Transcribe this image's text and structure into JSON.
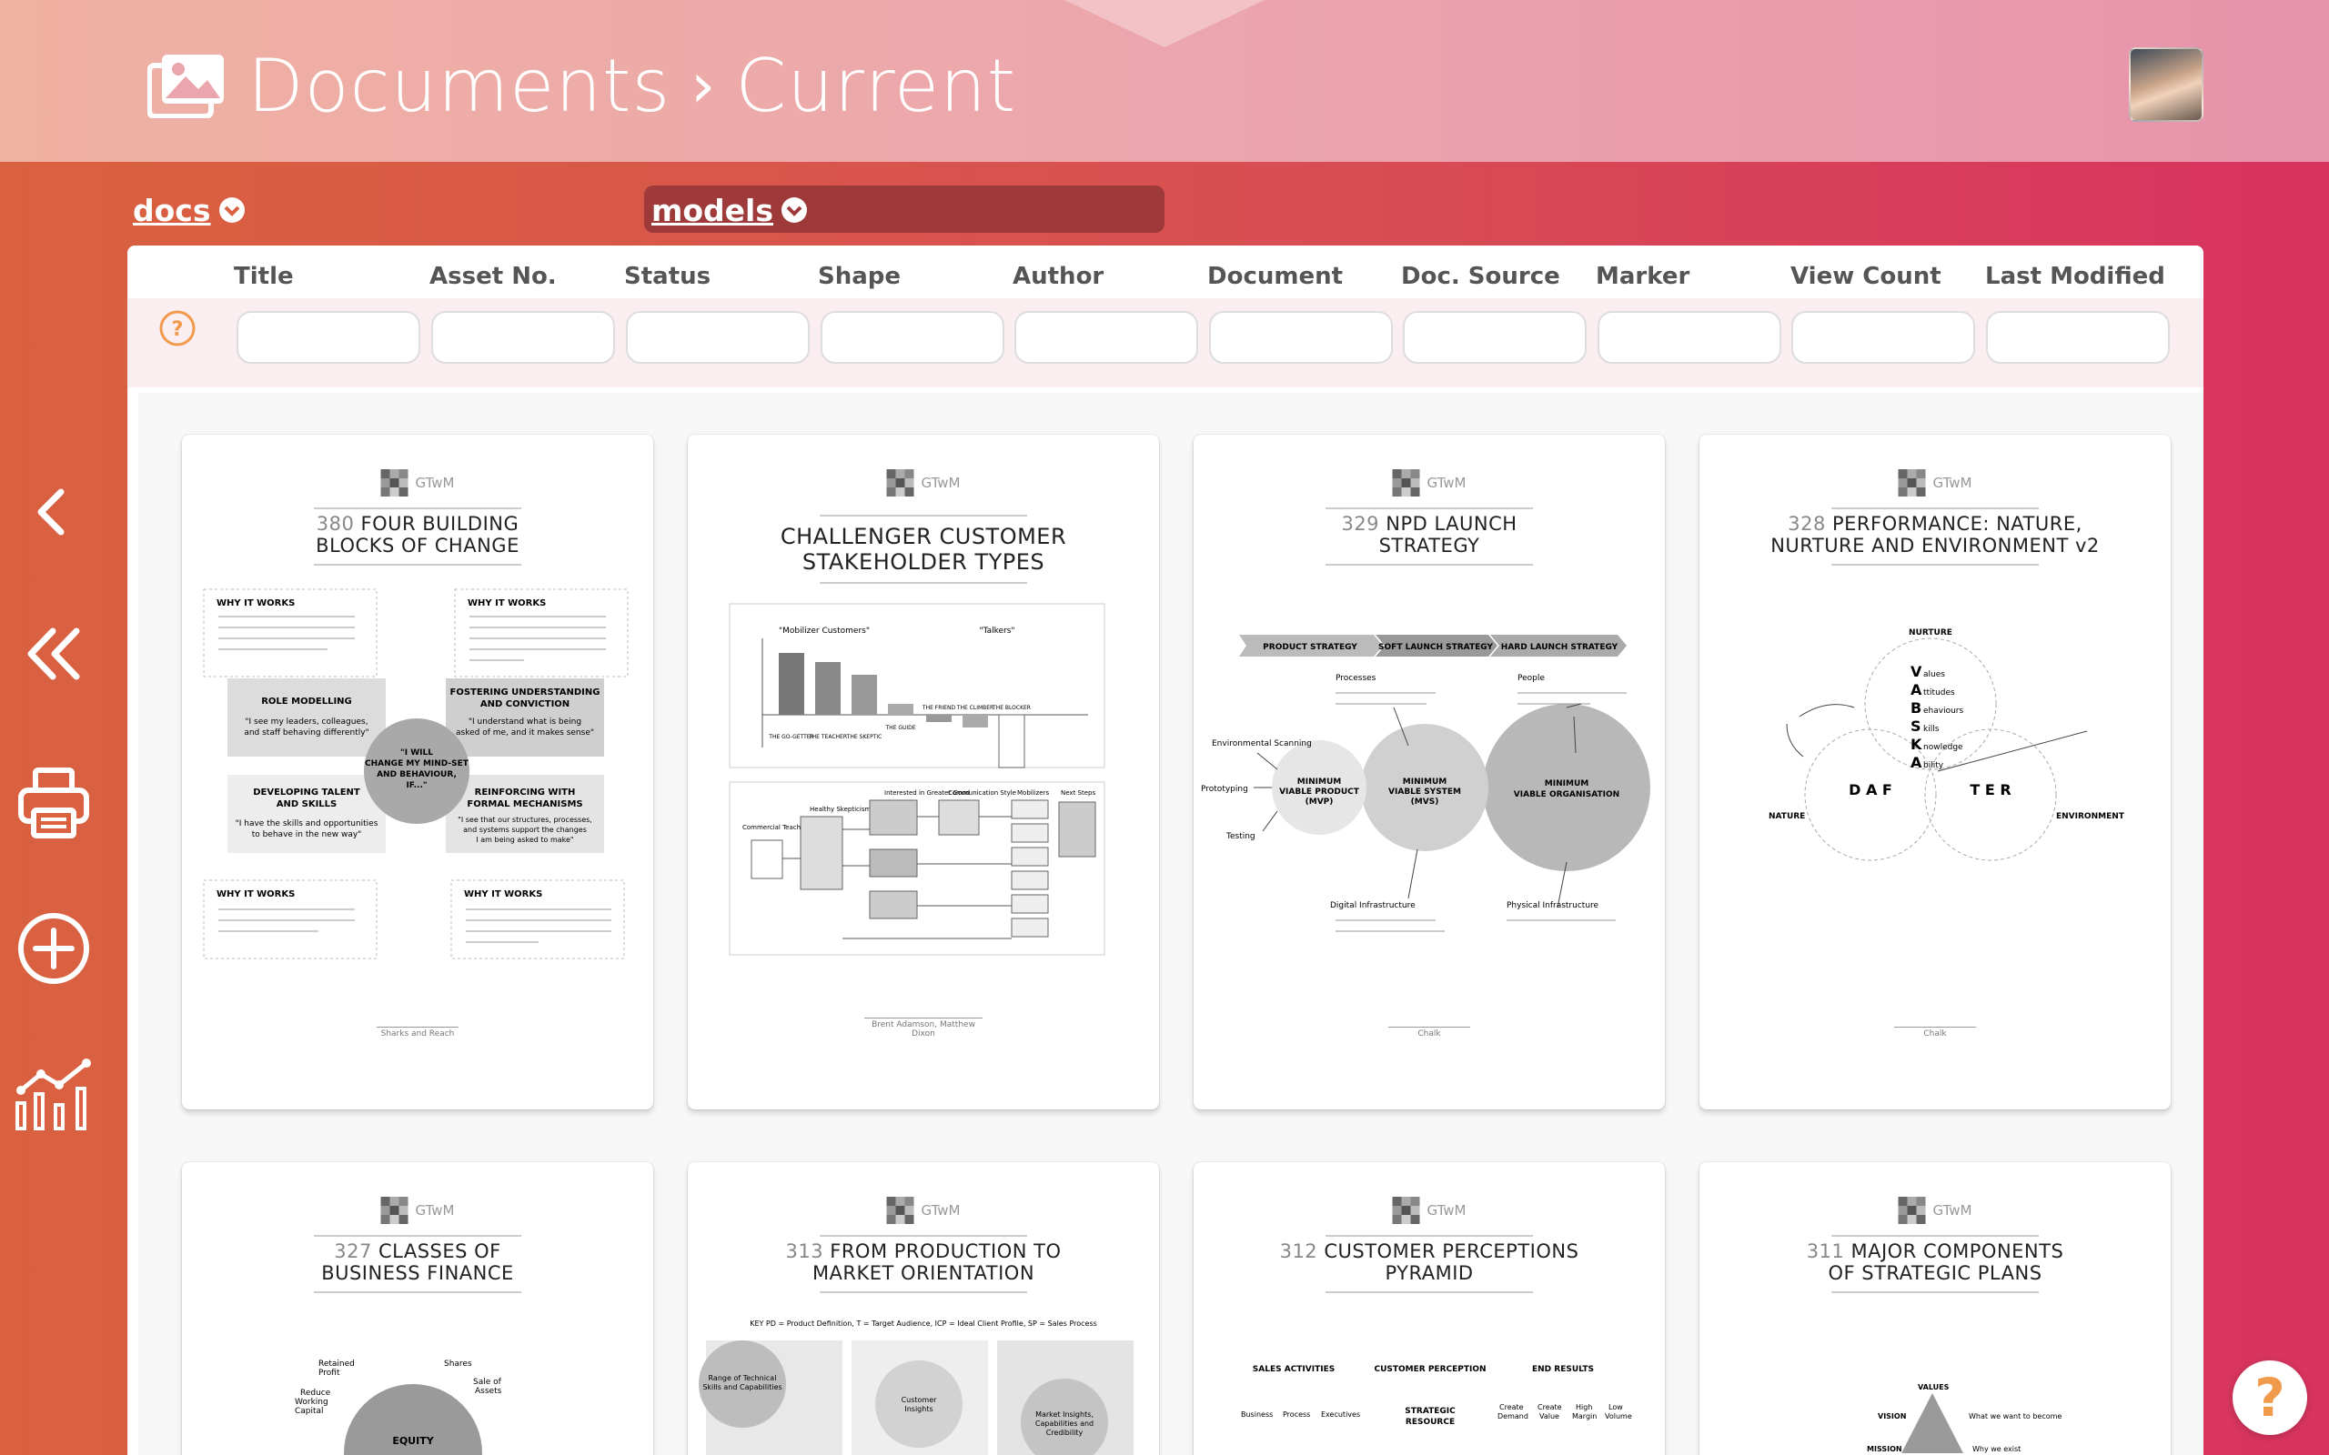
{
  "header": {
    "breadcrumb_root": "Documents",
    "breadcrumb_separator": "›",
    "breadcrumb_current": "Current"
  },
  "filters": {
    "docs_label": "docs",
    "models_label": "models"
  },
  "columns": [
    "Title",
    "Asset No.",
    "Status",
    "Shape",
    "Author",
    "Document",
    "Doc. Source",
    "Marker",
    "View Count",
    "Last Modified"
  ],
  "brand": "GTwM",
  "cards": [
    {
      "num": "380",
      "title_line1": "FOUR BUILDING",
      "title_line2": "BLOCKS OF CHANGE",
      "footer": "Sharks and Reach"
    },
    {
      "num": "",
      "title_line1": "CHALLENGER CUSTOMER",
      "title_line2": "STAKEHOLDER TYPES",
      "footer": "Brent Adamson, Matthew Dixon"
    },
    {
      "num": "329",
      "title_line1": "NPD LAUNCH",
      "title_line2": "STRATEGY",
      "footer": "Chalk"
    },
    {
      "num": "328",
      "title_line1": "PERFORMANCE: NATURE,",
      "title_line2": "NURTURE AND ENVIRONMENT v2",
      "footer": "Chalk"
    },
    {
      "num": "327",
      "title_line1": "CLASSES OF",
      "title_line2": "BUSINESS FINANCE",
      "footer": ""
    },
    {
      "num": "313",
      "title_line1": "FROM PRODUCTION TO",
      "title_line2": "MARKET ORIENTATION",
      "footer": ""
    },
    {
      "num": "312",
      "title_line1": "CUSTOMER PERCEPTIONS",
      "title_line2": "PYRAMID",
      "footer": ""
    },
    {
      "num": "311",
      "title_line1": "MAJOR COMPONENTS",
      "title_line2": "OF STRATEGIC PLANS",
      "footer": ""
    }
  ],
  "card_content": {
    "c0": {
      "why": "WHY IT WORKS",
      "role": "ROLE MODELLING",
      "role_q": "\"I see my leaders, colleagues, and staff behaving differently\"",
      "fost1": "FOSTERING UNDERSTANDING",
      "fost2": "AND CONVICTION",
      "fost_q": "\"I understand what is being asked of me, and it makes sense\"",
      "center1": "\"I WILL",
      "center2": "CHANGE MY MIND-SET",
      "center3": "AND BEHAVIOUR,",
      "center4": "IF...\"",
      "dev1": "DEVELOPING TALENT",
      "dev2": "AND SKILLS",
      "dev_q": "\"I have the skills and opportunities to behave in the new way\"",
      "reinf1": "REINFORCING WITH",
      "reinf2": "FORMAL MECHANISMS",
      "reinf_q": "\"I see that our structures, processes, and systems support the changes I am being asked to make\""
    },
    "c1": {
      "mob": "\"Mobilizer Customers\"",
      "talk": "\"Talkers\"",
      "bars": [
        "THE GO-GETTER",
        "THE TEACHER",
        "THE SKEPTIC",
        "THE GUIDE",
        "THE FRIEND",
        "THE CLIMBER",
        "THE BLOCKER"
      ],
      "flow": [
        "Commercial Teaching",
        "Healthy Skepticism",
        "Interested in Greater Good",
        "Communication Style",
        "Mobilizers",
        "Next Steps"
      ]
    },
    "c2": {
      "chev1": "PRODUCT STRATEGY",
      "chev2": "SOFT LAUNCH STRATEGY",
      "chev3": "HARD LAUNCH STRATEGY",
      "mvp1": "MINIMUM",
      "mvp2": "VIABLE PRODUCT",
      "mvp3": "(MVP)",
      "mvs1": "MINIMUM",
      "mvs2": "VIABLE SYSTEM",
      "mvs3": "(MVS)",
      "mvo1": "MINIMUM",
      "mvo2": "VIABLE ORGANISATION",
      "processes": "Processes",
      "people": "People",
      "env": "Environmental Scanning",
      "proto": "Prototyping",
      "testing": "Testing",
      "digital": "Digital Infrastructure",
      "physical": "Physical Infrastructure"
    },
    "c3": {
      "nurture": "NURTURE",
      "nature": "NATURE",
      "environment": "ENVIRONMENT",
      "vabsk": [
        "V",
        "A",
        "B",
        "S",
        "K",
        "A"
      ],
      "vabsk_rest": [
        "alues",
        "ttitudes",
        "ehaviours",
        "kills",
        "nowledge",
        "bility"
      ],
      "daf": "D A F",
      "ter": "T E R"
    },
    "c4": {
      "retained": "Retained Profit",
      "shares": "Shares",
      "reduce": "Reduce Working Capital",
      "sale": "Sale of Assets",
      "equity": "EQUITY"
    },
    "c5": {
      "key": "KEY PD = Product Definition, T = Target Audience, ICP = Ideal Client Profile, SP = Sales Process",
      "range": "Range of Technical Skills and Capabilities",
      "insights": "Customer Insights",
      "market": "Market Insights, Capabilities and Credibility"
    },
    "c6": {
      "sales": "SALES ACTIVITIES",
      "perception": "CUSTOMER PERCEPTION",
      "results": "END RESULTS",
      "business": "Business",
      "process": "Process",
      "executives": "Executives",
      "strategic": "STRATEGIC",
      "resource": "RESOURCE",
      "demand": "Create Demand",
      "value": "Create Value",
      "margin": "High Margin",
      "volume": "Low Volume"
    },
    "c7": {
      "values": "VALUES",
      "vision": "VISION",
      "mission": "MISSION",
      "become": "What we want to become",
      "exist": "Why we exist"
    }
  },
  "help_glyph": "?",
  "colors": {
    "accent": "#f19a4b",
    "header_bg": "#eba6ad",
    "models_chip": "#9e3a3a"
  }
}
